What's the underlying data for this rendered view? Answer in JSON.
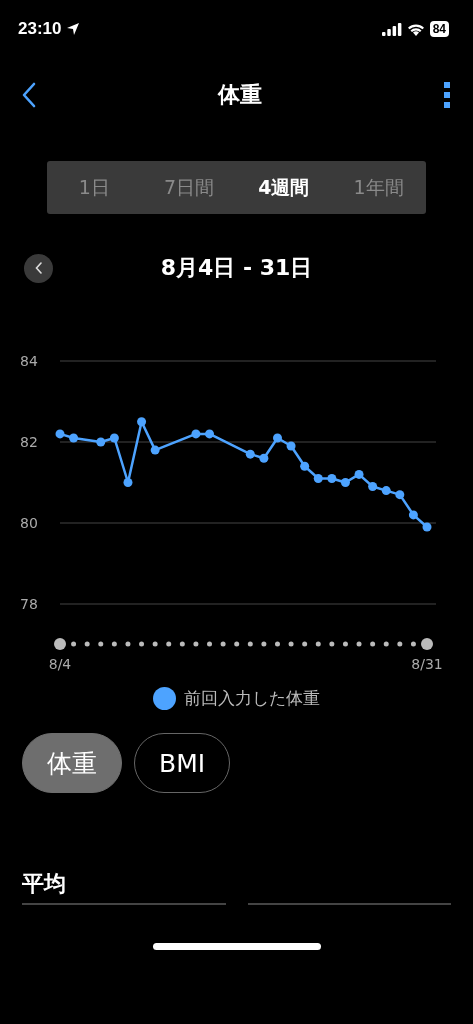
{
  "status_bar": {
    "time": "23:10",
    "battery": "84"
  },
  "nav": {
    "title": "体重"
  },
  "tabs": [
    {
      "label": "1日",
      "selected": false
    },
    {
      "label": "7日間",
      "selected": false
    },
    {
      "label": "4週間",
      "selected": true
    },
    {
      "label": "1年間",
      "selected": false
    }
  ],
  "date_range": "8月4日 - 31日",
  "chart": {
    "chart_data": {
      "type": "line",
      "categories": [
        "8/4",
        null,
        null,
        null,
        null,
        null,
        null,
        null,
        null,
        null,
        null,
        null,
        null,
        null,
        null,
        null,
        null,
        null,
        null,
        null,
        null,
        null,
        null,
        null,
        null,
        null,
        null,
        "8/31"
      ],
      "ylim": [
        78,
        84
      ],
      "yticks": [
        78,
        80,
        82,
        84
      ],
      "series": [
        {
          "name": "前回入力した体重",
          "color": "#4da3ff",
          "marker": "circle",
          "values": [
            82.2,
            82.1,
            null,
            82.0,
            82.1,
            81.0,
            82.5,
            81.8,
            null,
            null,
            82.2,
            82.2,
            null,
            null,
            81.7,
            81.6,
            82.1,
            81.9,
            81.4,
            81.1,
            81.1,
            81.0,
            81.2,
            80.9,
            80.8,
            80.7,
            80.2,
            79.9
          ]
        }
      ]
    }
  },
  "chips": [
    {
      "label": "体重",
      "selected": true
    },
    {
      "label": "BMI",
      "selected": false
    }
  ],
  "section_title": "平均"
}
